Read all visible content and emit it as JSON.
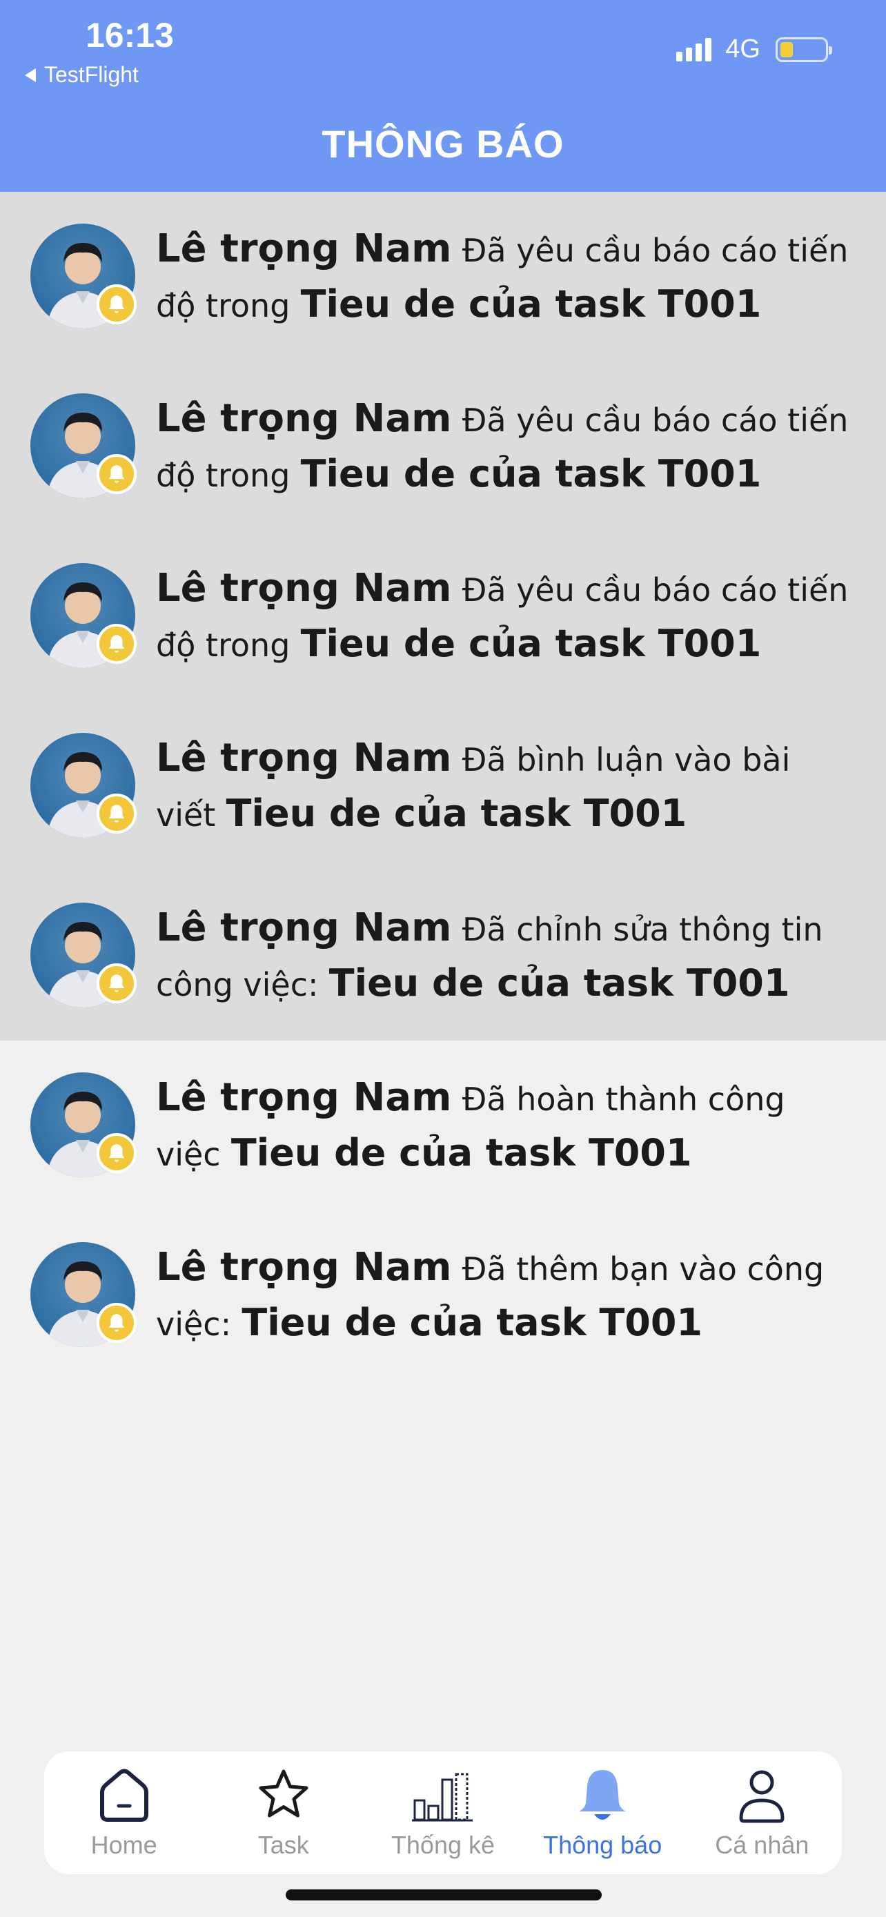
{
  "status_bar": {
    "time": "16:13",
    "back_label": "TestFlight",
    "network": "4G"
  },
  "header": {
    "title": "THÔNG BÁO"
  },
  "notifications": [
    {
      "name": "Lê trọng Nam",
      "action": "Đã yêu cầu báo cáo tiến độ trong",
      "task": "Tieu de của task T001",
      "read": false
    },
    {
      "name": "Lê trọng Nam",
      "action": "Đã yêu cầu báo cáo tiến độ trong",
      "task": "Tieu de của task T001",
      "read": false
    },
    {
      "name": "Lê trọng Nam",
      "action": "Đã yêu cầu báo cáo tiến độ trong",
      "task": "Tieu de của task T001",
      "read": false
    },
    {
      "name": "Lê trọng Nam",
      "action": "Đã bình luận vào bài viết",
      "task": "Tieu de của task T001",
      "read": false
    },
    {
      "name": "Lê trọng Nam",
      "action": "Đã chỉnh sửa thông tin công việc:",
      "task": "Tieu de của task T001",
      "read": false
    },
    {
      "name": "Lê trọng Nam",
      "action": "Đã hoàn thành công việc",
      "task": "Tieu de của task T001",
      "read": true
    },
    {
      "name": "Lê trọng Nam",
      "action": "Đã thêm bạn vào công việc:",
      "task": "Tieu de của task T001",
      "read": true
    }
  ],
  "tabs": [
    {
      "label": "Home",
      "icon": "home-icon",
      "active": false
    },
    {
      "label": "Task",
      "icon": "star-icon",
      "active": false
    },
    {
      "label": "Thống kê",
      "icon": "chart-icon",
      "active": false
    },
    {
      "label": "Thông báo",
      "icon": "bell-icon",
      "active": true
    },
    {
      "label": "Cá nhân",
      "icon": "user-icon",
      "active": false
    }
  ],
  "colors": {
    "header": "#6f98f5",
    "unread_bg": "#dcdcdc",
    "read_bg": "#f0f0f0",
    "badge": "#f3c73a",
    "active_tab": "#3b72e6",
    "inactive_tab": "#9a9a9a"
  }
}
